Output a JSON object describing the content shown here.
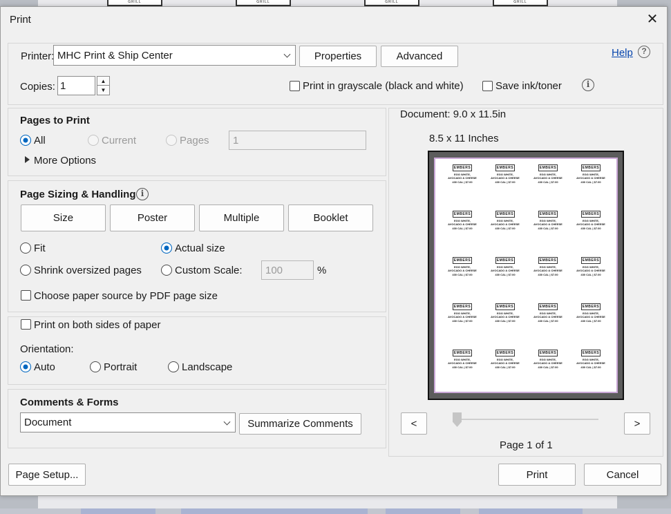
{
  "dialog": {
    "title": "Print"
  },
  "printer": {
    "label": "Printer:",
    "selected": "MHC Print & Ship Center",
    "properties_label": "Properties",
    "advanced_label": "Advanced",
    "help_label": "Help",
    "copies_label": "Copies:",
    "copies_value": "1",
    "grayscale_label": "Print in grayscale (black and white)",
    "save_ink_label": "Save ink/toner"
  },
  "pages_to_print": {
    "heading": "Pages to Print",
    "options": [
      {
        "label": "All",
        "selected": true,
        "enabled": true
      },
      {
        "label": "Current",
        "selected": false,
        "enabled": false
      },
      {
        "label": "Pages",
        "selected": false,
        "enabled": false
      }
    ],
    "pages_value": "1",
    "more_options_label": "More Options"
  },
  "page_sizing": {
    "heading": "Page Sizing & Handling",
    "modes": [
      {
        "label": "Size",
        "accesskey": "i"
      },
      {
        "label": "Poster"
      },
      {
        "label": "Multiple"
      },
      {
        "label": "Booklet"
      }
    ],
    "fit_label": "Fit",
    "actual_size_label": "Actual size",
    "shrink_label": "Shrink oversized pages",
    "custom_scale_label": "Custom Scale:",
    "custom_scale_value": "100",
    "percent_label": "%",
    "paper_source_label": "Choose paper source by PDF page size"
  },
  "duplex": {
    "both_sides_label": "Print on both sides of paper",
    "orientation_label": "Orientation:",
    "orientations": [
      {
        "label": "Auto",
        "selected": true
      },
      {
        "label": "Portrait",
        "selected": false
      },
      {
        "label": "Landscape",
        "selected": false
      }
    ]
  },
  "comments_forms": {
    "heading": "Comments & Forms",
    "selected": "Document",
    "summarize_label": "Summarize Comments"
  },
  "preview": {
    "document_size": "Document: 9.0 x 11.5in",
    "paper_size": "8.5 x 11 Inches",
    "prev_label": "<",
    "next_label": ">",
    "page_indicator": "Page 1 of 1",
    "label_logo": "EMBERS",
    "label_line1": "EGG WHITE,",
    "label_line2": "AVOCADO & CHEESE",
    "label_line3": "430 CAL | $7.00",
    "label_grid": {
      "rows": 5,
      "cols": 4
    }
  },
  "footer": {
    "page_setup_label": "Page Setup...",
    "print_label": "Print",
    "cancel_label": "Cancel"
  },
  "background": {
    "logo_text": "GRILL"
  },
  "colors": {
    "accent": "#0067c0",
    "link": "#0645ad",
    "sheet_border": "#c9a6d6"
  }
}
